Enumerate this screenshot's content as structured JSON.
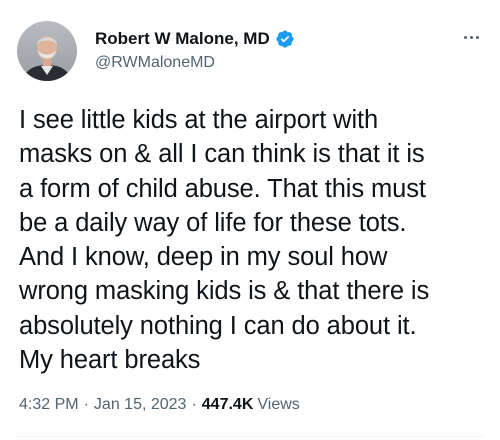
{
  "author": {
    "display_name": "Robert W Malone, MD",
    "handle": "@RWMaloneMD",
    "verified": true,
    "avatar": "profile-photo"
  },
  "tweet": {
    "text": "I see little kids at the airport with\nmasks on & all I can think is that it is\na form of child abuse. That this must\nbe a daily way of life for these tots.\nAnd I know, deep in my soul how\nwrong masking kids is & that there is\nabsolutely nothing I can do about it.\nMy heart breaks",
    "time": "4:32 PM",
    "separator": "·",
    "date": "Jan 15, 2023",
    "views_count": "447.4K",
    "views_label": "Views"
  },
  "icons": {
    "verified_badge": "verified-badge-icon",
    "more": "more-options-icon"
  },
  "colors": {
    "text_primary": "#0f1419",
    "text_secondary": "#536471",
    "verified_blue": "#1d9bf0",
    "background": "#ffffff"
  }
}
